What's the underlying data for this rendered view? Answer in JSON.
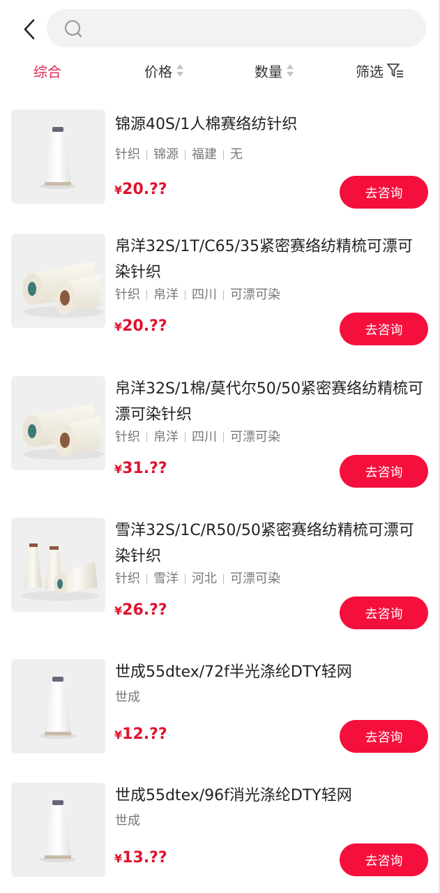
{
  "search": {
    "value": "",
    "placeholder": ""
  },
  "sort": {
    "comprehensive": "综合",
    "price": "价格",
    "quantity": "数量",
    "filter": "筛选"
  },
  "colors": {
    "accent": "#e0284a",
    "price": "#e0112f",
    "button": "#f50f3d"
  },
  "products": [
    {
      "title": "锦源40S/1人棉赛络纺针织",
      "tags": [
        "针织",
        "锦源",
        "福建",
        "无"
      ],
      "currency": "¥",
      "price": "20.??",
      "button": "去咨询",
      "image": "single-white-cone"
    },
    {
      "title": "帛洋32S/1T/C65/35紧密赛络纺精梳可漂可染针织",
      "tags": [
        "针织",
        "帛洋",
        "四川",
        "可漂可染"
      ],
      "currency": "¥",
      "price": "20.??",
      "button": "去咨询",
      "image": "two-cream-cones"
    },
    {
      "title": "帛洋32S/1棉/莫代尔50/50紧密赛络纺精梳可漂可染针织",
      "tags": [
        "针织",
        "帛洋",
        "四川",
        "可漂可染"
      ],
      "currency": "¥",
      "price": "31.??",
      "button": "去咨询",
      "image": "two-cream-cones"
    },
    {
      "title": "雪洋32S/1C/R50/50紧密赛络纺精梳可漂可染针织",
      "tags": [
        "针织",
        "雪洋",
        "河北",
        "可漂可染"
      ],
      "currency": "¥",
      "price": "26.??",
      "button": "去咨询",
      "image": "three-cream-cones"
    },
    {
      "title": "世成55dtex/72f半光涤纶DTY轻网",
      "tags": [
        "世成"
      ],
      "currency": "¥",
      "price": "12.??",
      "button": "去咨询",
      "image": "single-white-cone"
    },
    {
      "title": "世成55dtex/96f消光涤纶DTY轻网",
      "tags": [
        "世成"
      ],
      "currency": "¥",
      "price": "13.??",
      "button": "去咨询",
      "image": "single-white-cone"
    }
  ]
}
